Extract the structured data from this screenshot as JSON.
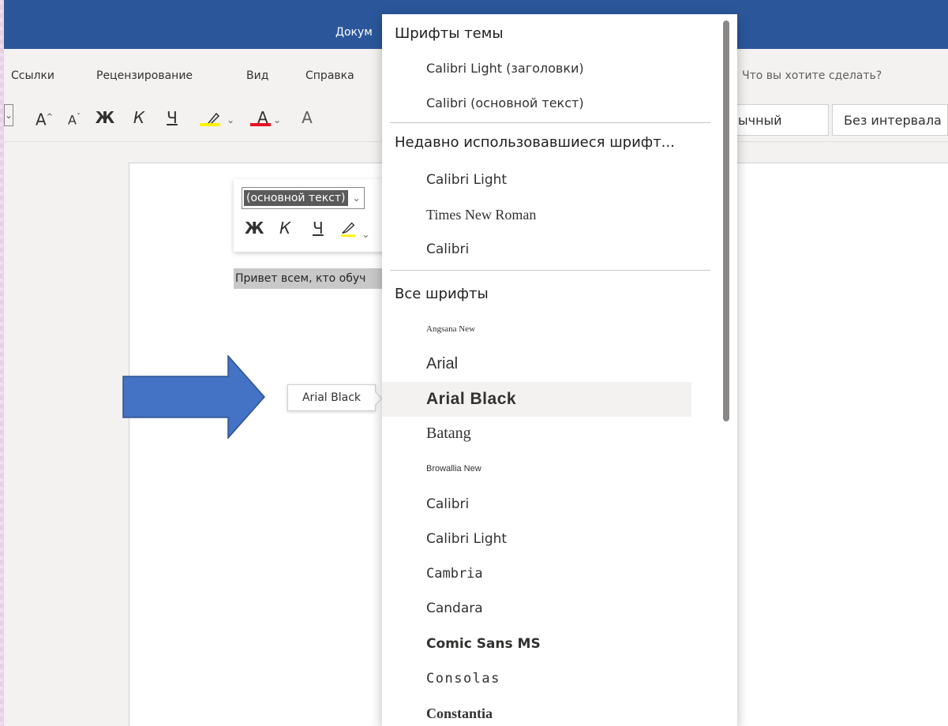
{
  "titlebar": {
    "title": "Докум"
  },
  "menu": {
    "items": [
      "Ссылки",
      "Рецензирование",
      "Вид",
      "Справка"
    ],
    "tell_me": "Что вы хотите сделать?"
  },
  "toolbar": {
    "grow_font": "A",
    "shrink_font": "A",
    "bold": "Ж",
    "italic": "К",
    "underline": "Ч",
    "font_color": "A",
    "clear_format": "A",
    "styles": [
      "ычный",
      "Без интервала"
    ],
    "highlight_color": "#fff200",
    "font_color_bar": "#e81123"
  },
  "mini_toolbar": {
    "font_value": "(основной текст)",
    "bold": "Ж",
    "italic": "К",
    "underline": "Ч"
  },
  "document": {
    "selected_text": "Привет всем, кто обуч"
  },
  "tooltip": {
    "text": "Arial Black"
  },
  "font_dropdown": {
    "theme_header": "Шрифты темы",
    "theme_fonts": [
      "Calibri Light (заголовки)",
      "Calibri (основной текст)"
    ],
    "recent_header": "Недавно использовавшиеся шрифт...",
    "recent_fonts": [
      "Calibri Light",
      "Times New Roman",
      "Calibri"
    ],
    "all_header": "Все шрифты",
    "all_fonts": [
      "Angsana New",
      "Arial",
      "Arial Black",
      "Batang",
      "Browallia New",
      "Calibri",
      "Calibri Light",
      "Cambria",
      "Candara",
      "Comic Sans MS",
      "Consolas",
      "Constantia"
    ],
    "hovered_font": "Arial Black"
  },
  "colors": {
    "titlebar": "#2b579a",
    "arrow_fill": "#4472c4",
    "arrow_stroke": "#2f528f"
  }
}
